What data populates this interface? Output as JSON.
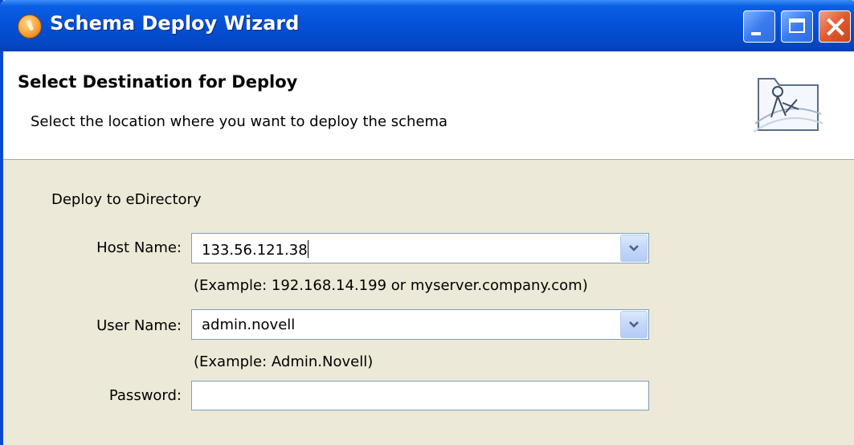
{
  "window": {
    "title": "Schema Deploy Wizard",
    "icons": {
      "app": "wizard-app-icon",
      "minimize": "minimize-icon",
      "maximize": "maximize-icon",
      "close": "close-icon"
    }
  },
  "header": {
    "title": "Select Destination for Deploy",
    "description": "Select the location where you want to deploy the schema",
    "image": "schema-deploy-banner-icon"
  },
  "form": {
    "section_label": "Deploy to eDirectory",
    "host": {
      "label": "Host Name:",
      "value": "133.56.121.38",
      "hint": "(Example: 192.168.14.199 or myserver.company.com)"
    },
    "user": {
      "label": "User Name:",
      "value": "admin.novell",
      "hint": "(Example:  Admin.Novell)"
    },
    "password": {
      "label": "Password:",
      "value": ""
    }
  },
  "colors": {
    "titlebar": "#0552d8",
    "window_bg": "#ece9d8",
    "header_bg": "#ffffff",
    "field_border": "#7f9db9"
  }
}
